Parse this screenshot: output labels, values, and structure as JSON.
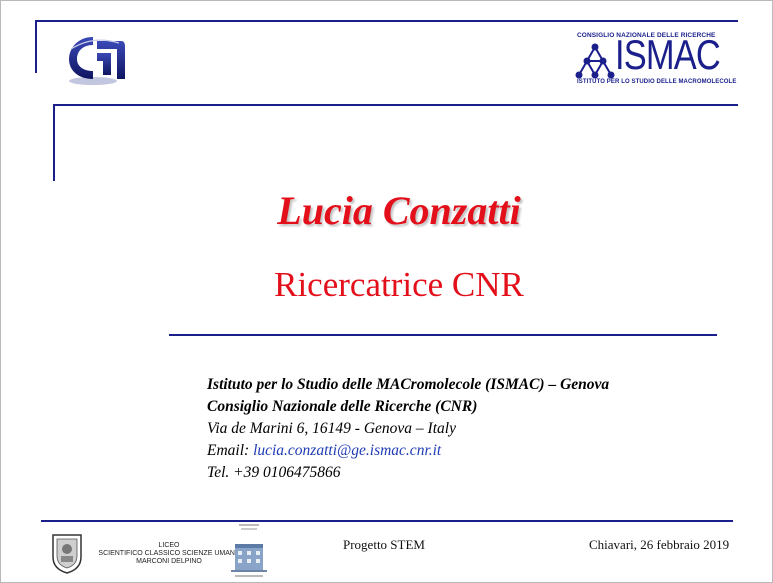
{
  "presenter": {
    "name": "Lucia Conzatti",
    "role": "Ricercatrice CNR"
  },
  "ismac_logo": {
    "top_text": "CONSIGLIO NAZIONALE DELLE RICERCHE",
    "word": "ISMAC",
    "bottom_text": "ISTITUTO PER LO STUDIO DELLE MACROMOLECOLE"
  },
  "affiliation": {
    "institute": "Istituto per lo Studio delle MACromolecole (ISMAC) – Genova",
    "council": "Consiglio Nazionale delle Ricerche (CNR)",
    "address": "Via de Marini 6, 16149 - Genova – Italy",
    "email_label": "Email: ",
    "email": "lucia.conzatti@ge.ismac.cnr.it",
    "phone": "Tel. +39 0106475866"
  },
  "footer": {
    "school_line1": "LICEO",
    "school_line2": "SCIENTIFICO CLASSICO SCIENZE UMANE",
    "school_line3": "MARCONI DELPINO",
    "project": "Progetto STEM",
    "date": "Chiavari, 26 febbraio 2019"
  },
  "colors": {
    "accent_red": "#e3101b",
    "rule_blue": "#1a1f8c",
    "link_blue": "#1f3bb5"
  },
  "icons": [
    "cnr-logo-icon",
    "ismac-molecule-icon",
    "liceo-crest-icon",
    "school-building-icon"
  ]
}
